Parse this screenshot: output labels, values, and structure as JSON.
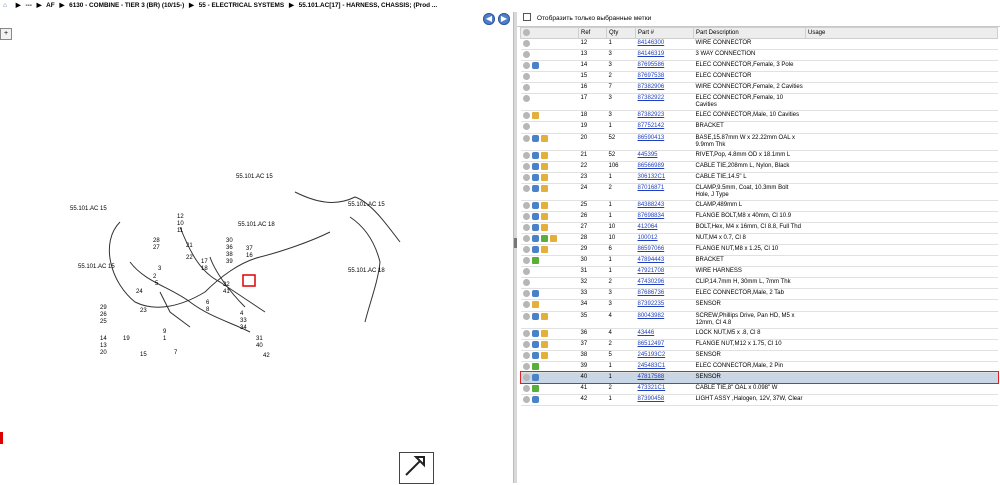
{
  "breadcrumb": {
    "items": [
      "---",
      "AF",
      "6130 - COMBINE - TIER 3 (BR) (10/15-)",
      "55 - ELECTRICAL SYSTEMS",
      "55.101.AC[17] - HARNESS, CHASSIS; (Prod ..."
    ]
  },
  "diagram": {
    "labels": [
      "55.101.AC 15",
      "55.101.AC 15",
      "55.101.AC 15",
      "55.101.AC 18",
      "55.101.AC 18",
      "55.101.AC 15"
    ],
    "callouts": [
      "12",
      "10",
      "11",
      "28",
      "27",
      "21",
      "22",
      "17",
      "18",
      "30",
      "36",
      "37",
      "16",
      "3",
      "2",
      "5",
      "24",
      "23",
      "6",
      "8",
      "29",
      "26",
      "25",
      "19",
      "9",
      "1",
      "4",
      "33",
      "34",
      "31",
      "40",
      "42",
      "14",
      "13",
      "15",
      "7",
      "20",
      "32",
      "41",
      "38",
      "39"
    ]
  },
  "filter": {
    "label": "Отобразить только выбранные метки"
  },
  "table": {
    "headers": [
      "Ref",
      "Qty",
      "Part #",
      "Part Description",
      "Usage"
    ],
    "rows": [
      {
        "icons": [
          "gray"
        ],
        "ref": "12",
        "qty": "1",
        "part": "84146300",
        "desc": "WIRE CONNECTOR",
        "usage": ""
      },
      {
        "icons": [
          "gray"
        ],
        "ref": "13",
        "qty": "3",
        "part": "84146319",
        "desc": "3 WAY CONNECTION",
        "usage": ""
      },
      {
        "icons": [
          "gray",
          "blue"
        ],
        "ref": "14",
        "qty": "3",
        "part": "87695586",
        "desc": "ELEC CONNECTOR,Female, 3 Pole",
        "usage": ""
      },
      {
        "icons": [
          "gray"
        ],
        "ref": "15",
        "qty": "2",
        "part": "87697538",
        "desc": "ELEC CONNECTOR",
        "usage": ""
      },
      {
        "icons": [
          "gray"
        ],
        "ref": "16",
        "qty": "7",
        "part": "87382906",
        "desc": "WIRE CONNECTOR,Female, 2 Cavities",
        "usage": ""
      },
      {
        "icons": [
          "gray"
        ],
        "ref": "17",
        "qty": "3",
        "part": "87382922",
        "desc": "ELEC CONNECTOR,Female, 10 Cavities",
        "usage": ""
      },
      {
        "icons": [
          "gray",
          "gold"
        ],
        "ref": "18",
        "qty": "3",
        "part": "87382923",
        "desc": "ELEC CONNECTOR,Male, 10 Cavities",
        "usage": ""
      },
      {
        "icons": [
          "gray"
        ],
        "ref": "19",
        "qty": "1",
        "part": "87752142",
        "desc": "BRACKET",
        "usage": ""
      },
      {
        "icons": [
          "gray",
          "blue",
          "gold"
        ],
        "ref": "20",
        "qty": "52",
        "part": "86590413",
        "desc": "BASE,15.87mm W x 22.22mm OAL x 9.9mm Thk",
        "usage": ""
      },
      {
        "icons": [
          "gray",
          "blue",
          "gold"
        ],
        "ref": "21",
        "qty": "52",
        "part": "445395",
        "desc": "RIVET,Pop, 4.8mm OD x 18.1mm L",
        "usage": ""
      },
      {
        "icons": [
          "gray",
          "blue",
          "gold"
        ],
        "ref": "22",
        "qty": "106",
        "part": "86566989",
        "desc": "CABLE TIE,208mm L, Nylon, Black",
        "usage": ""
      },
      {
        "icons": [
          "gray",
          "blue",
          "gold"
        ],
        "ref": "23",
        "qty": "1",
        "part": "306132C1",
        "desc": "CABLE TIE,14.5\" L",
        "usage": ""
      },
      {
        "icons": [
          "gray",
          "blue",
          "gold"
        ],
        "ref": "24",
        "qty": "2",
        "part": "87016871",
        "desc": "CLAMP,9.5mm, Coat, 10.3mm Bolt Hole, J Type",
        "usage": ""
      },
      {
        "icons": [
          "gray",
          "blue",
          "gold"
        ],
        "ref": "25",
        "qty": "1",
        "part": "84388243",
        "desc": "CLAMP,489mm L",
        "usage": ""
      },
      {
        "icons": [
          "gray",
          "blue",
          "gold"
        ],
        "ref": "26",
        "qty": "1",
        "part": "87698834",
        "desc": "FLANGE BOLT,M8 x 40mm, Cl 10.9",
        "usage": ""
      },
      {
        "icons": [
          "gray",
          "blue",
          "gold"
        ],
        "ref": "27",
        "qty": "10",
        "part": "412064",
        "desc": "BOLT,Hex, M4 x 16mm, Cl 8.8, Full Thd",
        "usage": ""
      },
      {
        "icons": [
          "gray",
          "blue",
          "green",
          "gold"
        ],
        "ref": "28",
        "qty": "10",
        "part": "100012",
        "desc": "NUT,M4 x 0.7, Cl 8",
        "usage": ""
      },
      {
        "icons": [
          "gray",
          "blue",
          "gold"
        ],
        "ref": "29",
        "qty": "6",
        "part": "86597066",
        "desc": "FLANGE NUT,M8 x 1.25, Cl 10",
        "usage": ""
      },
      {
        "icons": [
          "gray",
          "green"
        ],
        "ref": "30",
        "qty": "1",
        "part": "47894443",
        "desc": "BRACKET",
        "usage": ""
      },
      {
        "icons": [
          "gray"
        ],
        "ref": "31",
        "qty": "1",
        "part": "47921708",
        "desc": "WIRE HARNESS",
        "usage": ""
      },
      {
        "icons": [
          "gray"
        ],
        "ref": "32",
        "qty": "2",
        "part": "47430296",
        "desc": "CLIP,14.7mm H, 30mm L, 7mm Thk",
        "usage": ""
      },
      {
        "icons": [
          "gray",
          "blue"
        ],
        "ref": "33",
        "qty": "3",
        "part": "87686736",
        "desc": "ELEC CONNECTOR,Male, 2 Tab",
        "usage": ""
      },
      {
        "icons": [
          "gray",
          "gold"
        ],
        "ref": "34",
        "qty": "3",
        "part": "87392235",
        "desc": "SENSOR",
        "usage": ""
      },
      {
        "icons": [
          "gray",
          "blue",
          "gold"
        ],
        "ref": "35",
        "qty": "4",
        "part": "80043982",
        "desc": "SCREW,Phillips Drive, Pan HD, M5 x 12mm, Cl 4.8",
        "usage": ""
      },
      {
        "icons": [
          "gray",
          "blue",
          "gold"
        ],
        "ref": "36",
        "qty": "4",
        "part": "43446",
        "desc": "LOCK NUT,M5 x .8, Cl 8",
        "usage": ""
      },
      {
        "icons": [
          "gray",
          "blue",
          "gold"
        ],
        "ref": "37",
        "qty": "2",
        "part": "86512497",
        "desc": "FLANGE NUT,M12 x 1.75, Cl 10",
        "usage": ""
      },
      {
        "icons": [
          "gray",
          "blue",
          "gold"
        ],
        "ref": "38",
        "qty": "5",
        "part": "245193C2",
        "desc": "SENSOR",
        "usage": ""
      },
      {
        "icons": [
          "gray",
          "green"
        ],
        "ref": "39",
        "qty": "1",
        "part": "245483C1",
        "desc": "ELEC CONNECTOR,Male, 2 Pin",
        "usage": ""
      },
      {
        "icons": [
          "gray",
          "blue"
        ],
        "ref": "40",
        "qty": "1",
        "part": "47817588",
        "desc": "SENSOR",
        "usage": "",
        "selected": true
      },
      {
        "icons": [
          "gray",
          "green"
        ],
        "ref": "41",
        "qty": "2",
        "part": "473321C1",
        "desc": "CABLE TIE,8\" OAL x 0.098\" W",
        "usage": ""
      },
      {
        "icons": [
          "gray",
          "blue"
        ],
        "ref": "42",
        "qty": "1",
        "part": "87390458",
        "desc": "LIGHT ASSY ,Halogen, 12V, 37W, Clear",
        "usage": ""
      }
    ]
  }
}
